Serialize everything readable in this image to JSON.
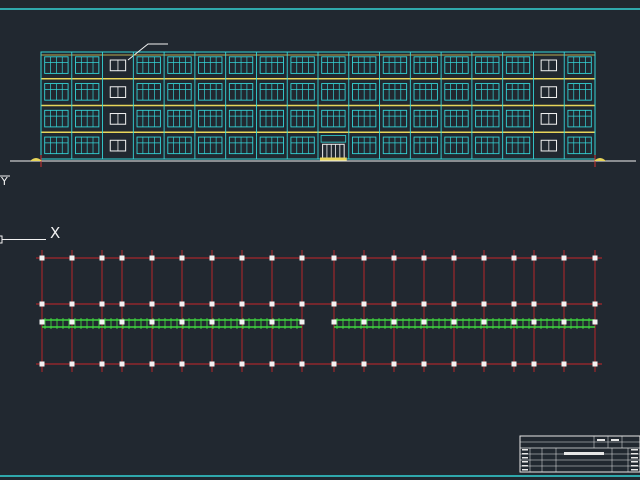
{
  "canvas": {
    "background": "#212830",
    "frame_color": "#34d3d6",
    "elevation_line_color": "#34d3d6",
    "floor_band_color": "#e8d55a",
    "grid_line_color": "#c8262a",
    "column_color": "#f2f2f2",
    "wall_color": "#3fd63f",
    "title_block_color": "#e6e6e6"
  },
  "ucs": {
    "x_label": "X",
    "y_label": "Y"
  },
  "elevation": {
    "bays": 18,
    "floors": 4,
    "stair_bays": [
      2,
      16
    ],
    "entrance_bay": 9
  },
  "plan": {
    "column_count": 19,
    "wall_gap_after_column": 9
  },
  "title_block": {
    "drawing_name": "",
    "cells": []
  }
}
